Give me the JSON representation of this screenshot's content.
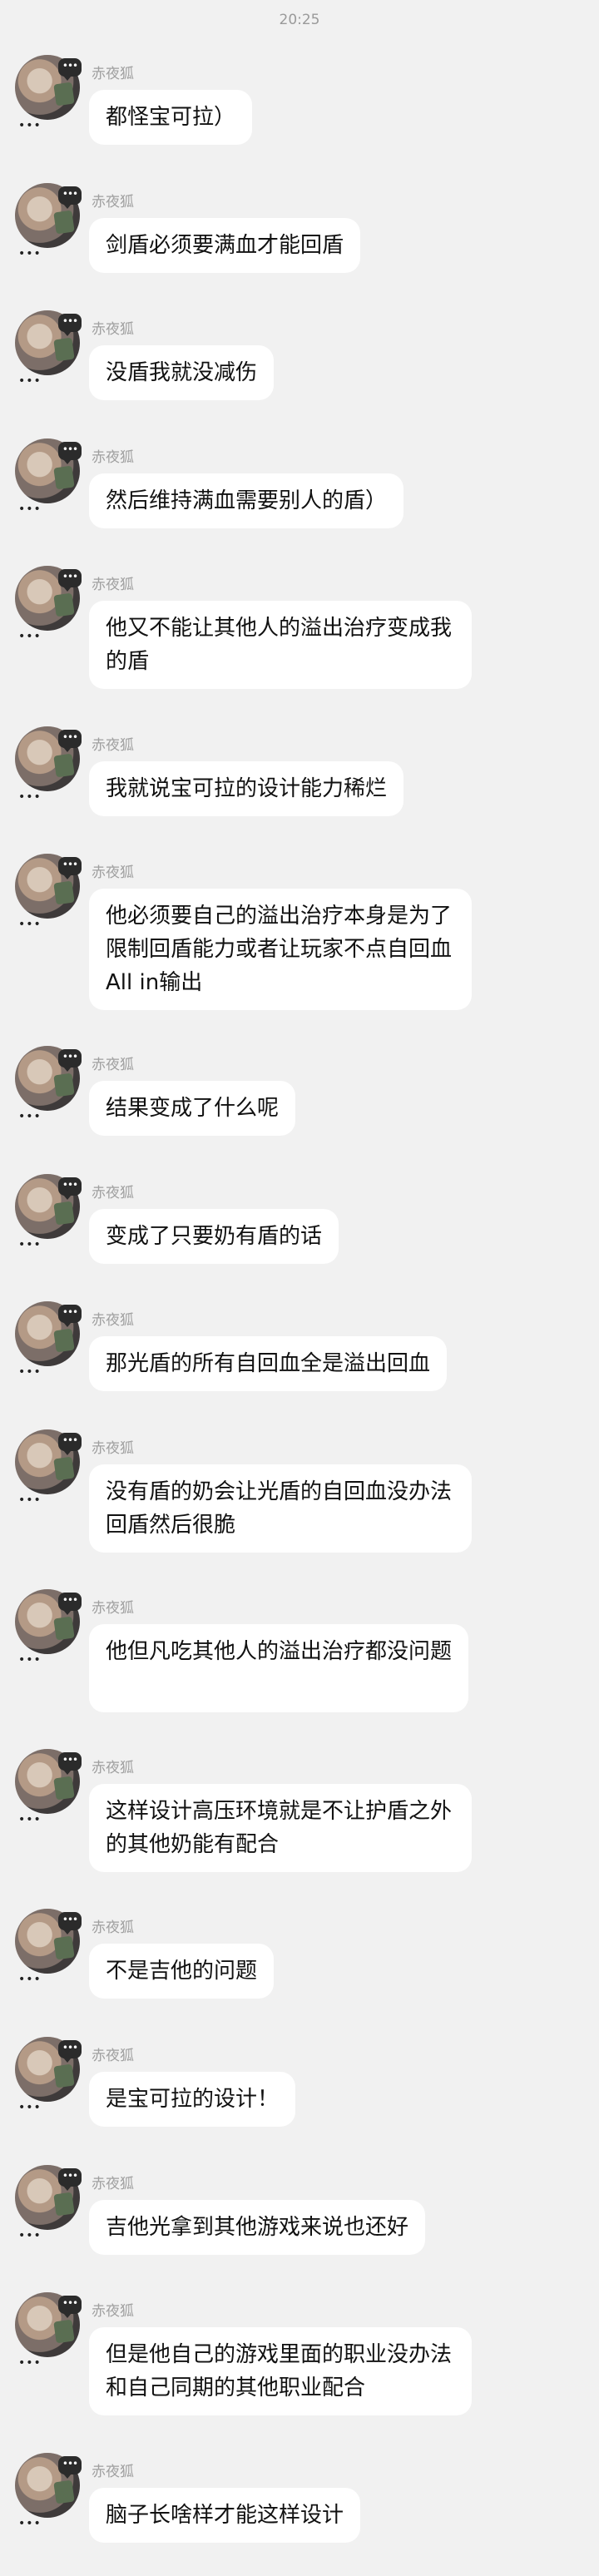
{
  "status": {
    "time": "20:25"
  },
  "sender_name": "赤夜狐",
  "messages": [
    {
      "text": "都怪宝可拉）"
    },
    {
      "text": "剑盾必须要满血才能回盾"
    },
    {
      "text": "没盾我就没减伤"
    },
    {
      "text": "然后维持满血需要别人的盾）"
    },
    {
      "text": "他又不能让其他人的溢出治疗变成我的盾"
    },
    {
      "text": "我就说宝可拉的设计能力稀烂"
    },
    {
      "text": "他必须要自己的溢出治疗本身是为了限制回盾能力或者让玩家不点自回血All in输出"
    },
    {
      "text": "结果变成了什么呢"
    },
    {
      "text": "变成了只要奶有盾的话"
    },
    {
      "text": "那光盾的所有自回血全是溢出回血"
    },
    {
      "text": "没有盾的奶会让光盾的自回血没办法回盾然后很脆"
    },
    {
      "text": "他但凡吃其他人的溢出治疗都没问题"
    },
    {
      "text": "这样设计高压环境就是不让护盾之外的其他奶能有配合"
    },
    {
      "text": "不是吉他的问题"
    },
    {
      "text": "是宝可拉的设计！"
    },
    {
      "text": "吉他光拿到其他游戏来说也还好"
    },
    {
      "text": "但是他自己的游戏里面的职业没办法和自己同期的其他职业配合"
    },
    {
      "text": "脑子长啥样才能这样设计"
    }
  ]
}
